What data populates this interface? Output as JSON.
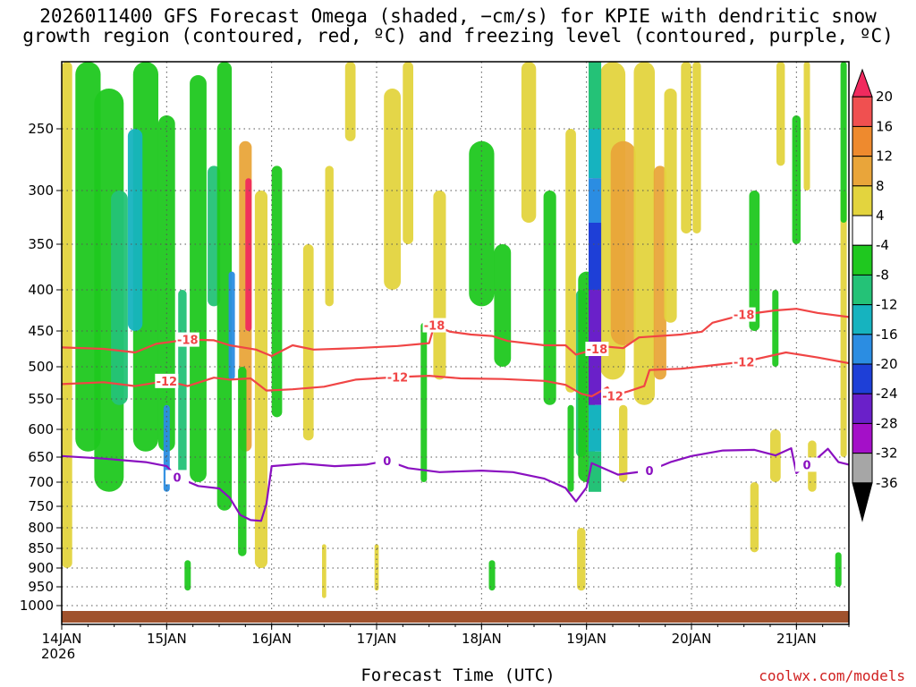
{
  "title_line1": "2026011400 GFS Forecast Omega (shaded, −cm/s) for KPIE with dendritic snow",
  "title_line2": "growth region (contoured, red, ºC) and freezing level (contoured, purple, ºC)",
  "credit": "coolwx.com/models",
  "chart_data": {
    "type": "heatmap",
    "title": "2026011400 GFS Forecast Omega (shaded, −cm/s) for KPIE with dendritic snow growth region (contoured, red, ºC) and freezing level (contoured, purple, ºC)",
    "xlabel": "Forecast Time (UTC)",
    "ylabel": "",
    "x_ticks": [
      "14JAN",
      "15JAN",
      "16JAN",
      "17JAN",
      "18JAN",
      "19JAN",
      "20JAN",
      "21JAN"
    ],
    "x_year": "2026",
    "x_range_days": [
      0,
      7.5
    ],
    "y_ticks": [
      250,
      300,
      350,
      400,
      450,
      500,
      550,
      600,
      650,
      700,
      750,
      800,
      850,
      900,
      950,
      1000
    ],
    "y_range_hpa": [
      200,
      1025
    ],
    "colorbar": {
      "levels": [
        20,
        16,
        12,
        8,
        4,
        -4,
        -8,
        -12,
        -16,
        -20,
        -24,
        -28,
        -32,
        -36
      ],
      "colors": [
        "#f02a5e",
        "#f05050",
        "#ee8a2e",
        "#e9a53a",
        "#e3d43e",
        "#ffffff",
        "#1fc81f",
        "#24c277",
        "#16b3bf",
        "#2b8de2",
        "#1e3fd7",
        "#6a20c9",
        "#a410c8",
        "#a6a6a6",
        "#000000"
      ]
    },
    "contours": [
      {
        "name": "-18",
        "color": "#f04545",
        "points": [
          [
            0.0,
            473
          ],
          [
            0.4,
            475
          ],
          [
            0.7,
            480
          ],
          [
            0.9,
            468
          ],
          [
            1.2,
            462
          ],
          [
            1.45,
            463
          ],
          [
            1.6,
            470
          ],
          [
            1.85,
            476
          ],
          [
            2.0,
            485
          ],
          [
            2.2,
            470
          ],
          [
            2.4,
            476
          ],
          [
            2.8,
            474
          ],
          [
            3.2,
            471
          ],
          [
            3.5,
            467
          ],
          [
            3.55,
            443
          ],
          [
            3.7,
            451
          ],
          [
            3.9,
            455
          ],
          [
            4.1,
            457
          ],
          [
            4.25,
            464
          ],
          [
            4.6,
            470
          ],
          [
            4.8,
            470
          ],
          [
            4.9,
            483
          ],
          [
            5.0,
            479
          ],
          [
            5.1,
            475
          ],
          [
            5.2,
            472
          ],
          [
            5.35,
            474
          ],
          [
            5.5,
            459
          ],
          [
            5.9,
            455
          ],
          [
            6.1,
            451
          ],
          [
            6.2,
            440
          ],
          [
            6.5,
            430
          ],
          [
            6.8,
            425
          ],
          [
            7.0,
            423
          ],
          [
            7.2,
            428
          ],
          [
            7.5,
            433
          ]
        ]
      },
      {
        "name": "-12",
        "color": "#f04545",
        "points": [
          [
            0.0,
            527
          ],
          [
            0.4,
            524
          ],
          [
            0.7,
            530
          ],
          [
            1.0,
            522
          ],
          [
            1.2,
            530
          ],
          [
            1.45,
            517
          ],
          [
            1.6,
            520
          ],
          [
            1.8,
            518
          ],
          [
            1.95,
            537
          ],
          [
            2.2,
            535
          ],
          [
            2.5,
            531
          ],
          [
            2.8,
            520
          ],
          [
            3.2,
            516
          ],
          [
            3.5,
            514
          ],
          [
            3.8,
            518
          ],
          [
            4.2,
            519
          ],
          [
            4.6,
            522
          ],
          [
            4.8,
            528
          ],
          [
            4.95,
            542
          ],
          [
            5.05,
            546
          ],
          [
            5.2,
            532
          ],
          [
            5.25,
            545
          ],
          [
            5.4,
            538
          ],
          [
            5.55,
            530
          ],
          [
            5.6,
            505
          ],
          [
            5.9,
            503
          ],
          [
            6.2,
            498
          ],
          [
            6.5,
            493
          ],
          [
            6.9,
            480
          ],
          [
            7.2,
            487
          ],
          [
            7.5,
            495
          ]
        ]
      },
      {
        "name": "0",
        "color": "#8a10c0",
        "points": [
          [
            0.0,
            648
          ],
          [
            0.4,
            653
          ],
          [
            0.8,
            660
          ],
          [
            1.0,
            668
          ],
          [
            1.1,
            690
          ],
          [
            1.3,
            708
          ],
          [
            1.5,
            713
          ],
          [
            1.6,
            732
          ],
          [
            1.7,
            770
          ],
          [
            1.8,
            782
          ],
          [
            1.9,
            784
          ],
          [
            1.95,
            745
          ],
          [
            2.0,
            668
          ],
          [
            2.3,
            663
          ],
          [
            2.6,
            668
          ],
          [
            2.9,
            665
          ],
          [
            3.1,
            657
          ],
          [
            3.3,
            672
          ],
          [
            3.6,
            680
          ],
          [
            4.0,
            677
          ],
          [
            4.3,
            680
          ],
          [
            4.6,
            693
          ],
          [
            4.8,
            712
          ],
          [
            4.9,
            740
          ],
          [
            5.0,
            711
          ],
          [
            5.05,
            662
          ],
          [
            5.3,
            685
          ],
          [
            5.6,
            677
          ],
          [
            5.8,
            660
          ],
          [
            6.0,
            648
          ],
          [
            6.3,
            638
          ],
          [
            6.6,
            637
          ],
          [
            6.8,
            647
          ],
          [
            6.95,
            634
          ],
          [
            7.0,
            682
          ],
          [
            7.1,
            665
          ],
          [
            7.2,
            652
          ],
          [
            7.3,
            635
          ],
          [
            7.4,
            660
          ],
          [
            7.5,
            665
          ]
        ]
      }
    ]
  }
}
